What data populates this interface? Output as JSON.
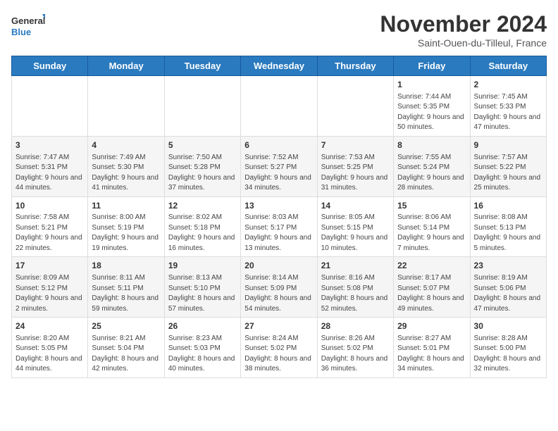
{
  "logo": {
    "general": "General",
    "blue": "Blue"
  },
  "title": "November 2024",
  "subtitle": "Saint-Ouen-du-Tilleul, France",
  "weekdays": [
    "Sunday",
    "Monday",
    "Tuesday",
    "Wednesday",
    "Thursday",
    "Friday",
    "Saturday"
  ],
  "weeks": [
    [
      {
        "day": "",
        "info": ""
      },
      {
        "day": "",
        "info": ""
      },
      {
        "day": "",
        "info": ""
      },
      {
        "day": "",
        "info": ""
      },
      {
        "day": "",
        "info": ""
      },
      {
        "day": "1",
        "info": "Sunrise: 7:44 AM\nSunset: 5:35 PM\nDaylight: 9 hours and 50 minutes."
      },
      {
        "day": "2",
        "info": "Sunrise: 7:45 AM\nSunset: 5:33 PM\nDaylight: 9 hours and 47 minutes."
      }
    ],
    [
      {
        "day": "3",
        "info": "Sunrise: 7:47 AM\nSunset: 5:31 PM\nDaylight: 9 hours and 44 minutes."
      },
      {
        "day": "4",
        "info": "Sunrise: 7:49 AM\nSunset: 5:30 PM\nDaylight: 9 hours and 41 minutes."
      },
      {
        "day": "5",
        "info": "Sunrise: 7:50 AM\nSunset: 5:28 PM\nDaylight: 9 hours and 37 minutes."
      },
      {
        "day": "6",
        "info": "Sunrise: 7:52 AM\nSunset: 5:27 PM\nDaylight: 9 hours and 34 minutes."
      },
      {
        "day": "7",
        "info": "Sunrise: 7:53 AM\nSunset: 5:25 PM\nDaylight: 9 hours and 31 minutes."
      },
      {
        "day": "8",
        "info": "Sunrise: 7:55 AM\nSunset: 5:24 PM\nDaylight: 9 hours and 28 minutes."
      },
      {
        "day": "9",
        "info": "Sunrise: 7:57 AM\nSunset: 5:22 PM\nDaylight: 9 hours and 25 minutes."
      }
    ],
    [
      {
        "day": "10",
        "info": "Sunrise: 7:58 AM\nSunset: 5:21 PM\nDaylight: 9 hours and 22 minutes."
      },
      {
        "day": "11",
        "info": "Sunrise: 8:00 AM\nSunset: 5:19 PM\nDaylight: 9 hours and 19 minutes."
      },
      {
        "day": "12",
        "info": "Sunrise: 8:02 AM\nSunset: 5:18 PM\nDaylight: 9 hours and 16 minutes."
      },
      {
        "day": "13",
        "info": "Sunrise: 8:03 AM\nSunset: 5:17 PM\nDaylight: 9 hours and 13 minutes."
      },
      {
        "day": "14",
        "info": "Sunrise: 8:05 AM\nSunset: 5:15 PM\nDaylight: 9 hours and 10 minutes."
      },
      {
        "day": "15",
        "info": "Sunrise: 8:06 AM\nSunset: 5:14 PM\nDaylight: 9 hours and 7 minutes."
      },
      {
        "day": "16",
        "info": "Sunrise: 8:08 AM\nSunset: 5:13 PM\nDaylight: 9 hours and 5 minutes."
      }
    ],
    [
      {
        "day": "17",
        "info": "Sunrise: 8:09 AM\nSunset: 5:12 PM\nDaylight: 9 hours and 2 minutes."
      },
      {
        "day": "18",
        "info": "Sunrise: 8:11 AM\nSunset: 5:11 PM\nDaylight: 8 hours and 59 minutes."
      },
      {
        "day": "19",
        "info": "Sunrise: 8:13 AM\nSunset: 5:10 PM\nDaylight: 8 hours and 57 minutes."
      },
      {
        "day": "20",
        "info": "Sunrise: 8:14 AM\nSunset: 5:09 PM\nDaylight: 8 hours and 54 minutes."
      },
      {
        "day": "21",
        "info": "Sunrise: 8:16 AM\nSunset: 5:08 PM\nDaylight: 8 hours and 52 minutes."
      },
      {
        "day": "22",
        "info": "Sunrise: 8:17 AM\nSunset: 5:07 PM\nDaylight: 8 hours and 49 minutes."
      },
      {
        "day": "23",
        "info": "Sunrise: 8:19 AM\nSunset: 5:06 PM\nDaylight: 8 hours and 47 minutes."
      }
    ],
    [
      {
        "day": "24",
        "info": "Sunrise: 8:20 AM\nSunset: 5:05 PM\nDaylight: 8 hours and 44 minutes."
      },
      {
        "day": "25",
        "info": "Sunrise: 8:21 AM\nSunset: 5:04 PM\nDaylight: 8 hours and 42 minutes."
      },
      {
        "day": "26",
        "info": "Sunrise: 8:23 AM\nSunset: 5:03 PM\nDaylight: 8 hours and 40 minutes."
      },
      {
        "day": "27",
        "info": "Sunrise: 8:24 AM\nSunset: 5:02 PM\nDaylight: 8 hours and 38 minutes."
      },
      {
        "day": "28",
        "info": "Sunrise: 8:26 AM\nSunset: 5:02 PM\nDaylight: 8 hours and 36 minutes."
      },
      {
        "day": "29",
        "info": "Sunrise: 8:27 AM\nSunset: 5:01 PM\nDaylight: 8 hours and 34 minutes."
      },
      {
        "day": "30",
        "info": "Sunrise: 8:28 AM\nSunset: 5:00 PM\nDaylight: 8 hours and 32 minutes."
      }
    ]
  ]
}
